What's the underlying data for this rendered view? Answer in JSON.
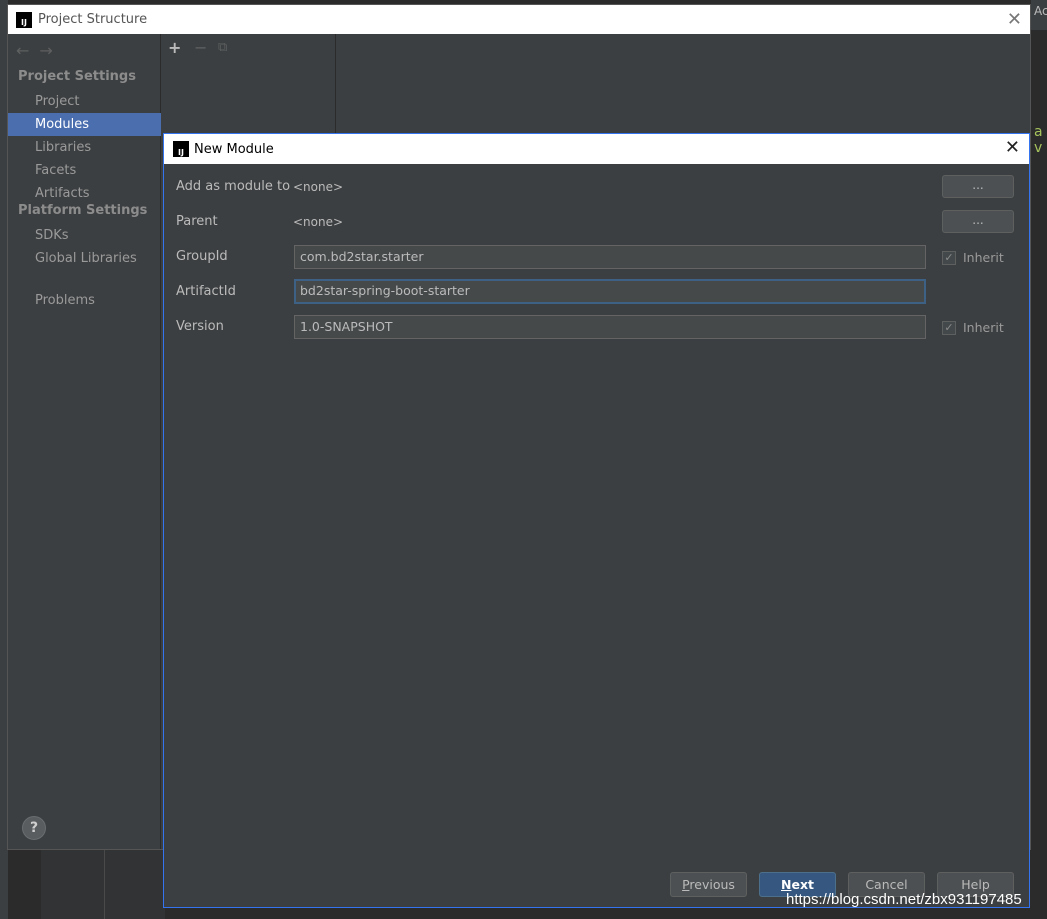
{
  "background": {
    "right_text_top": "Ac",
    "right_text_mid": "a v"
  },
  "project_structure": {
    "title": "Project Structure",
    "title_icon": "IJ",
    "sections": {
      "project_settings": "Project Settings",
      "platform_settings": "Platform Settings"
    },
    "items": {
      "project": "Project",
      "modules": "Modules",
      "libraries": "Libraries",
      "facets": "Facets",
      "artifacts": "Artifacts",
      "sdks": "SDKs",
      "global_libraries": "Global Libraries",
      "problems": "Problems"
    },
    "help": "?"
  },
  "new_module": {
    "title": "New Module",
    "title_icon": "IJ",
    "add_as_module_to": {
      "label": "Add as module to",
      "value": "<none>",
      "button": "..."
    },
    "parent": {
      "label": "Parent",
      "value": "<none>",
      "button": "..."
    },
    "group_id": {
      "label": "GroupId",
      "value": "com.bd2star.starter",
      "inherit": "Inherit"
    },
    "artifact_id": {
      "label": "ArtifactId",
      "value": "bd2star-spring-boot-starter"
    },
    "version": {
      "label": "Version",
      "value": "1.0-SNAPSHOT",
      "inherit": "Inherit"
    },
    "buttons": {
      "previous_mnemonic": "P",
      "previous_rest": "revious",
      "next_mnemonic": "N",
      "next_rest": "ext",
      "cancel": "Cancel",
      "help": "Help"
    }
  },
  "watermark": "https://blog.csdn.net/zbx931197485"
}
